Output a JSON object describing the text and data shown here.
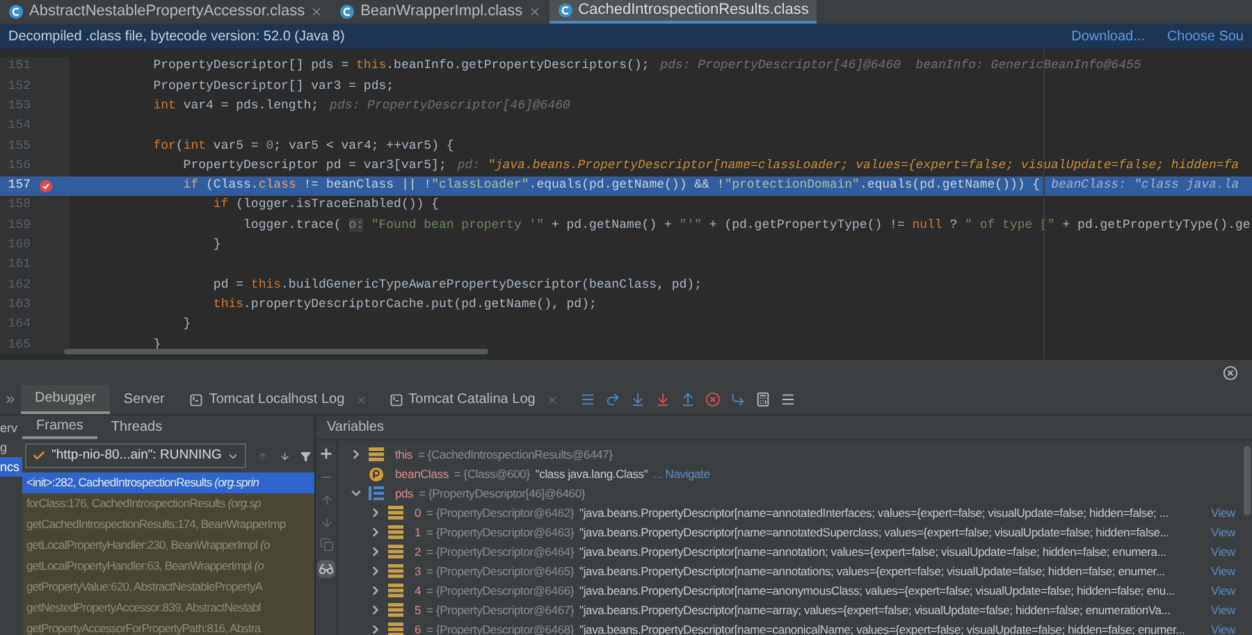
{
  "editor_tabs": [
    {
      "label": "AbstractNestablePropertyAccessor.class",
      "selected": false,
      "closable": true
    },
    {
      "label": "BeanWrapperImpl.class",
      "selected": false,
      "closable": true
    },
    {
      "label": "CachedIntrospectionResults.class",
      "selected": true,
      "closable": false
    }
  ],
  "info_bar": {
    "message": "Decompiled .class file, bytecode version: 52.0 (Java 8)",
    "links": [
      "Download...",
      "Choose Sou"
    ]
  },
  "code_lines": [
    {
      "number": "151",
      "current": false,
      "breakpoint": false,
      "segments": [
        {
          "kind": "plain",
          "text": "        PropertyDescriptor[] pds = "
        },
        {
          "kind": "keyword",
          "text": "this"
        },
        {
          "kind": "plain",
          "text": ".beanInfo.getPropertyDescriptors();"
        }
      ],
      "hint": [
        {
          "kind": "label",
          "text": "pds: PropertyDescriptor[46]@6460  beanInfo: GenericBeanInfo@6455"
        }
      ]
    },
    {
      "number": "152",
      "current": false,
      "breakpoint": false,
      "segments": [
        {
          "kind": "plain",
          "text": "        PropertyDescriptor[] var3 = pds;"
        }
      ]
    },
    {
      "number": "153",
      "current": false,
      "breakpoint": false,
      "segments": [
        {
          "kind": "keyword",
          "text": "        int"
        },
        {
          "kind": "plain",
          "text": " var4 = pds.length;"
        }
      ],
      "hint": [
        {
          "kind": "label",
          "text": "pds: PropertyDescriptor[46]@6460"
        }
      ]
    },
    {
      "number": "154",
      "current": false,
      "breakpoint": false
    },
    {
      "number": "155",
      "current": false,
      "breakpoint": false,
      "segments": [
        {
          "kind": "keyword",
          "text": "        for"
        },
        {
          "kind": "plain",
          "text": "("
        },
        {
          "kind": "keyword",
          "text": "int"
        },
        {
          "kind": "plain",
          "text": " var5 = "
        },
        {
          "kind": "number",
          "text": "0"
        },
        {
          "kind": "plain",
          "text": "; var5 < var4; ++var5) {"
        }
      ]
    },
    {
      "number": "156",
      "current": false,
      "breakpoint": false,
      "segments": [
        {
          "kind": "plain",
          "text": "            PropertyDescriptor pd = var3[var5];"
        }
      ],
      "hint": [
        {
          "kind": "label",
          "text": "pd: "
        },
        {
          "kind": "value",
          "text": "\"java.beans.PropertyDescriptor[name=classLoader; values={expert=false; visualUpdate=false; hidden=fa"
        }
      ]
    },
    {
      "number": "157",
      "current": true,
      "breakpoint": true,
      "segments": [
        {
          "kind": "keyword",
          "text": "            if"
        },
        {
          "kind": "plain",
          "text": " (Class."
        },
        {
          "kind": "keyword",
          "text": "class"
        },
        {
          "kind": "plain",
          "text": " != beanClass || !"
        },
        {
          "kind": "string",
          "text": "\"classLoader\""
        },
        {
          "kind": "plain",
          "text": ".equals(pd.getName()) && !"
        },
        {
          "kind": "string",
          "text": "\"protectionDomain\""
        },
        {
          "kind": "plain",
          "text": ".equals(pd.getName())) {"
        }
      ],
      "hint": [
        {
          "kind": "label",
          "text": "beanClass: \"class java.la"
        }
      ]
    },
    {
      "number": "158",
      "current": false,
      "breakpoint": false,
      "segments": [
        {
          "kind": "keyword",
          "text": "                if"
        },
        {
          "kind": "plain",
          "text": " (logger.isTraceEnabled()) {"
        }
      ]
    },
    {
      "number": "159",
      "current": false,
      "breakpoint": false,
      "segments": [
        {
          "kind": "plain",
          "text": "                    logger.trace( "
        },
        {
          "kind": "param",
          "text": "o:"
        },
        {
          "kind": "string",
          "text": " \"Found bean property '\""
        },
        {
          "kind": "plain",
          "text": " + pd.getName() + "
        },
        {
          "kind": "string",
          "text": "\"'\""
        },
        {
          "kind": "plain",
          "text": " + (pd.getPropertyType() != "
        },
        {
          "kind": "keyword",
          "text": "null"
        },
        {
          "kind": "plain",
          "text": " ? "
        },
        {
          "kind": "string",
          "text": "\" of type [\""
        },
        {
          "kind": "plain",
          "text": " + pd.getPropertyType().ge"
        }
      ]
    },
    {
      "number": "160",
      "current": false,
      "breakpoint": false,
      "segments": [
        {
          "kind": "plain",
          "text": "                }"
        }
      ]
    },
    {
      "number": "161",
      "current": false,
      "breakpoint": false
    },
    {
      "number": "162",
      "current": false,
      "breakpoint": false,
      "segments": [
        {
          "kind": "plain",
          "text": "                pd = "
        },
        {
          "kind": "keyword",
          "text": "this"
        },
        {
          "kind": "plain",
          "text": ".buildGenericTypeAwarePropertyDescriptor(beanClass, pd);"
        }
      ]
    },
    {
      "number": "163",
      "current": false,
      "breakpoint": false,
      "segments": [
        {
          "kind": "keyword",
          "text": "                this"
        },
        {
          "kind": "plain",
          "text": ".propertyDescriptorCache.put(pd.getName(), pd);"
        }
      ]
    },
    {
      "number": "164",
      "current": false,
      "breakpoint": false,
      "segments": [
        {
          "kind": "plain",
          "text": "            }"
        }
      ]
    },
    {
      "number": "165",
      "current": false,
      "breakpoint": false,
      "segments": [
        {
          "kind": "plain",
          "text": "        }"
        }
      ]
    }
  ],
  "side_panel": {
    "items": [
      {
        "label": "erv",
        "selected": false
      },
      {
        "label": "g",
        "selected": false
      },
      {
        "label": "ncs",
        "selected": true
      }
    ]
  },
  "debug_tabs": [
    {
      "label": "Debugger",
      "selected": true,
      "kind": "plain"
    },
    {
      "label": "Server",
      "selected": false,
      "kind": "plain"
    },
    {
      "label": "Tomcat Localhost Log",
      "selected": false,
      "kind": "log"
    },
    {
      "label": "Tomcat Catalina Log",
      "selected": false,
      "kind": "log"
    }
  ],
  "frames_tabs": [
    {
      "label": "Frames",
      "selected": true
    },
    {
      "label": "Threads",
      "selected": false
    }
  ],
  "thread_selector": {
    "value": "\"http-nio-80...ain\": RUNNING"
  },
  "frames": [
    {
      "text": "<init>:282, CachedIntrospectionResults *(org.sprin*",
      "selected": true
    },
    {
      "text": "forClass:176, CachedIntrospectionResults *(org.sp*",
      "selected": false
    },
    {
      "text": "getCachedIntrospectionResults:174, BeanWrapperImp",
      "selected": false
    },
    {
      "text": "getLocalPropertyHandler:230, BeanWrapperImpl *(o*",
      "selected": false
    },
    {
      "text": "getLocalPropertyHandler:63, BeanWrapperImpl *(o*",
      "selected": false
    },
    {
      "text": "getPropertyValue:620, AbstractNestablePropertyA",
      "selected": false
    },
    {
      "text": "getNestedPropertyAccessor:839, AbstractNestabl",
      "selected": false
    },
    {
      "text": "getPropertyAccessorForPropertyPath:816, Abstra",
      "selected": false
    }
  ],
  "variables_title": "Variables",
  "variables": [
    {
      "kind": "field",
      "name": "this",
      "ref": "= {CachedIntrospectionResults@6447}",
      "expanded": false
    },
    {
      "kind": "param",
      "name": "beanClass",
      "ref": "= {Class@600}",
      "value": "\"class java.lang.Class\"",
      "link": "... Navigate"
    },
    {
      "kind": "array",
      "name": "pds",
      "ref": "= {PropertyDescriptor[46]@6460}",
      "expanded": true,
      "children": [
        {
          "kind": "field",
          "name": "0",
          "ref": "= {PropertyDescriptor@6462}",
          "value": "\"java.beans.PropertyDescriptor[name=annotatedInterfaces; values={expert=false; visualUpdate=false; hidden=false; ...",
          "link": "View",
          "expanded": false
        },
        {
          "kind": "field",
          "name": "1",
          "ref": "= {PropertyDescriptor@6463}",
          "value": "\"java.beans.PropertyDescriptor[name=annotatedSuperclass; values={expert=false; visualUpdate=false; hidden=false...",
          "link": "View",
          "expanded": false
        },
        {
          "kind": "field",
          "name": "2",
          "ref": "= {PropertyDescriptor@6464}",
          "value": "\"java.beans.PropertyDescriptor[name=annotation; values={expert=false; visualUpdate=false; hidden=false; enumera...",
          "link": "View",
          "expanded": false
        },
        {
          "kind": "field",
          "name": "3",
          "ref": "= {PropertyDescriptor@6465}",
          "value": "\"java.beans.PropertyDescriptor[name=annotations; values={expert=false; visualUpdate=false; hidden=false; enumer...",
          "link": "View",
          "expanded": false
        },
        {
          "kind": "field",
          "name": "4",
          "ref": "= {PropertyDescriptor@6466}",
          "value": "\"java.beans.PropertyDescriptor[name=anonymousClass; values={expert=false; visualUpdate=false; hidden=false; enu...",
          "link": "View",
          "expanded": false
        },
        {
          "kind": "field",
          "name": "5",
          "ref": "= {PropertyDescriptor@6467}",
          "value": "\"java.beans.PropertyDescriptor[name=array; values={expert=false; visualUpdate=false; hidden=false; enumerationVa...",
          "link": "View",
          "expanded": false
        },
        {
          "kind": "field",
          "name": "6",
          "ref": "= {PropertyDescriptor@6468}",
          "value": "\"java.beans.PropertyDescriptor[name=canonicalName; values={expert=false; visualUpdate=false; hidden=false; enumer...",
          "link": "View",
          "expanded": false
        }
      ]
    }
  ]
}
